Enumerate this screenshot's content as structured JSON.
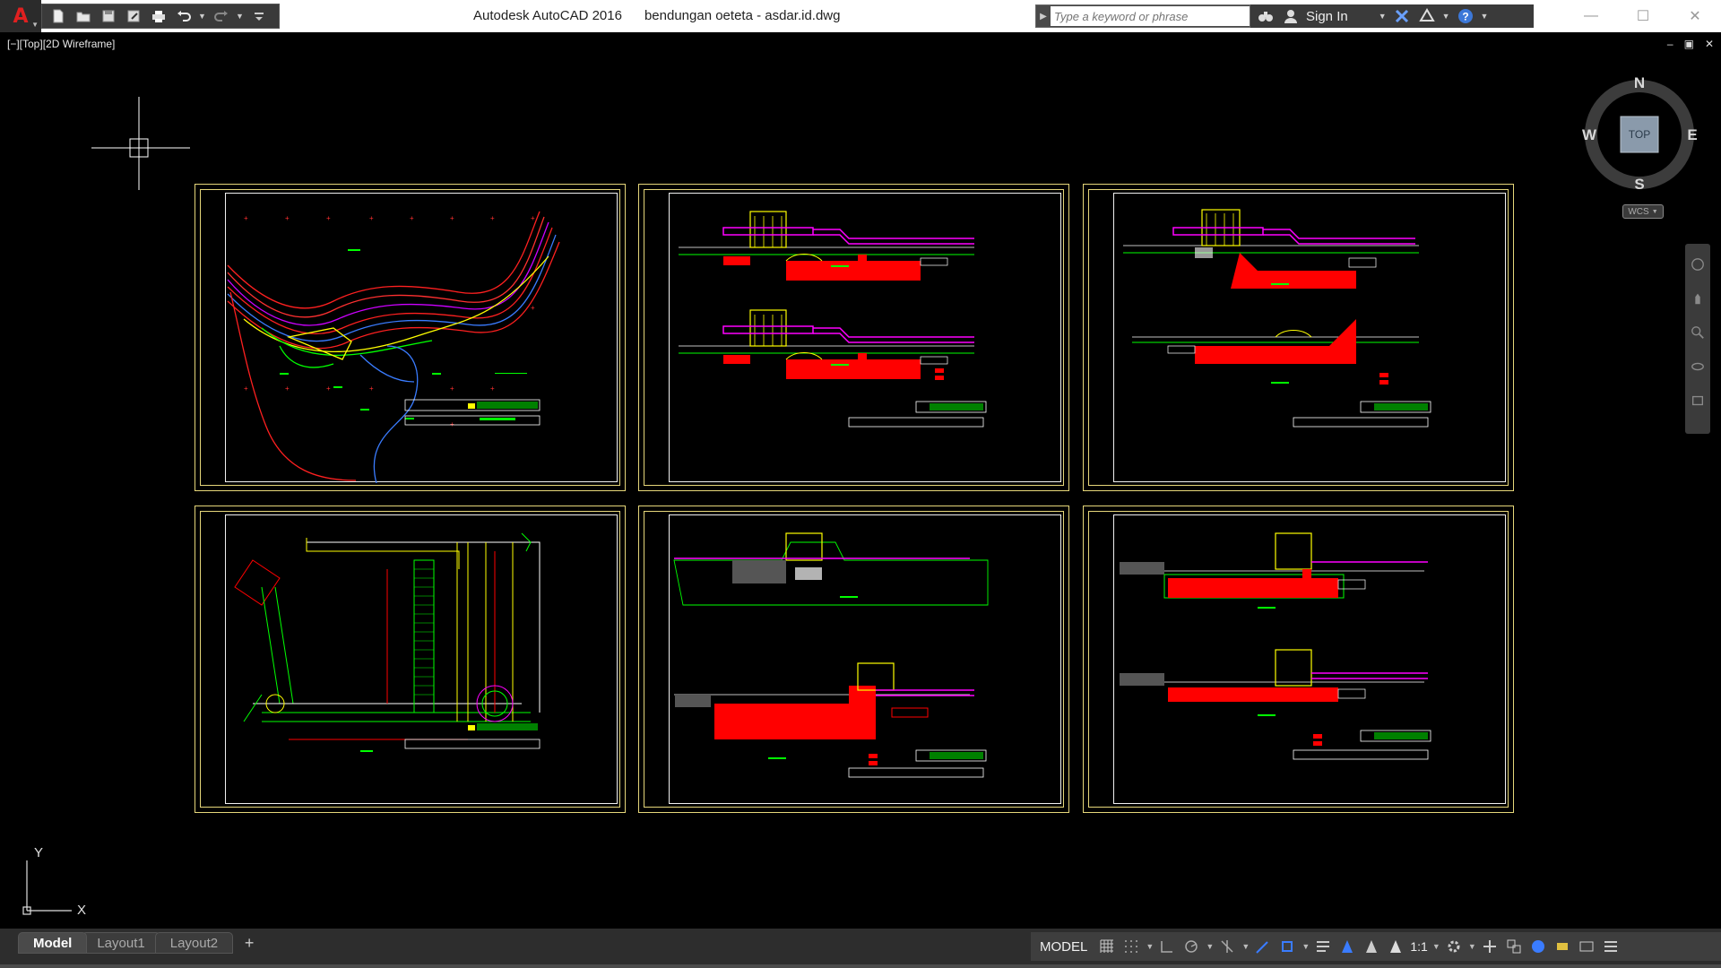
{
  "app": {
    "title": "Autodesk AutoCAD 2016",
    "document": "bendungan oeteta - asdar.id.dwg",
    "logo_letter": "A"
  },
  "quick_access": {
    "icons": [
      "new-icon",
      "open-icon",
      "save-icon",
      "save-as-icon",
      "plot-icon",
      "undo-icon",
      "redo-icon",
      "customize-icon"
    ]
  },
  "search": {
    "placeholder": "Type a keyword or phrase"
  },
  "infocenter": {
    "signin_label": "Sign In"
  },
  "viewport": {
    "label": "[−][Top][2D Wireframe]",
    "controls": [
      "–",
      "▣",
      "✕"
    ]
  },
  "viewcube": {
    "north": "N",
    "south": "S",
    "east": "E",
    "west": "W",
    "face": "TOP",
    "wcs": "WCS"
  },
  "ucs": {
    "x_label": "X",
    "y_label": "Y"
  },
  "colors": {
    "sheet_frame": "#e6d77a",
    "red": "#ff0000",
    "magenta": "#ff00ff",
    "yellow": "#ffff00",
    "green": "#00ff00",
    "cyan": "#00ffff",
    "blue": "#3a7cff"
  },
  "layout_tabs": [
    {
      "label": "Model",
      "active": true
    },
    {
      "label": "Layout1",
      "active": false
    },
    {
      "label": "Layout2",
      "active": false
    }
  ],
  "add_tab": "+",
  "status": {
    "model_label": "MODEL",
    "scale": "1:1"
  }
}
